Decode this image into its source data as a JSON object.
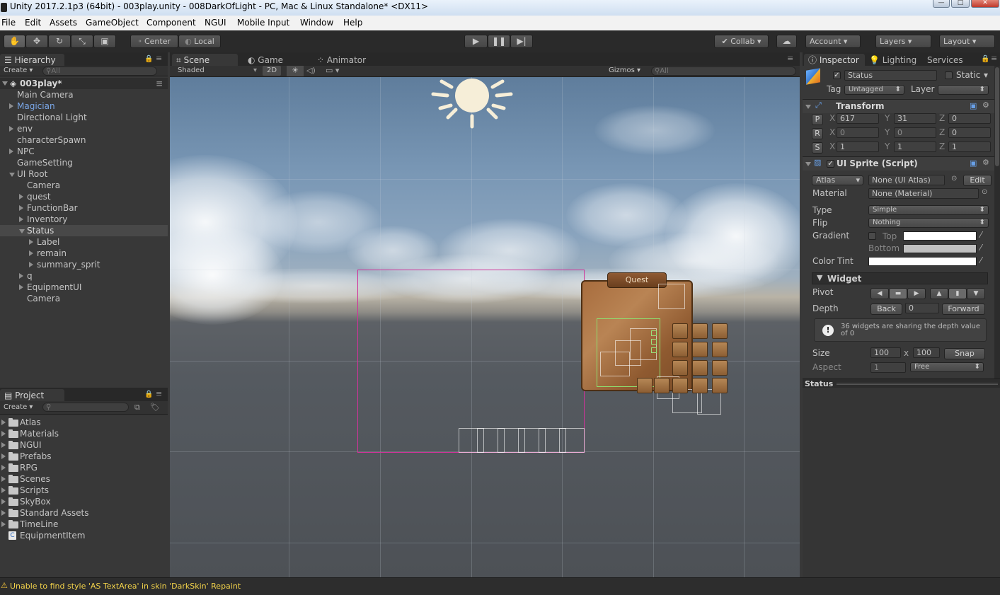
{
  "window": {
    "title": "Unity 2017.2.1p3 (64bit) - 003play.unity - 008DarkOfLight - PC, Mac & Linux Standalone* <DX11>",
    "min_label": "—",
    "max_label": "□",
    "close_label": "✕"
  },
  "menu": [
    "File",
    "Edit",
    "Assets",
    "GameObject",
    "Component",
    "NGUI",
    "Mobile Input",
    "Window",
    "Help"
  ],
  "toolbar": {
    "center": "Center",
    "local": "Local",
    "collab": "Collab",
    "account": "Account",
    "layers": "Layers",
    "layout": "Layout"
  },
  "hierarchy": {
    "tab": "Hierarchy",
    "create": "Create",
    "search_placeholder": "All",
    "scene_name": "003play*",
    "items": [
      {
        "label": "Main Camera",
        "depth": 1,
        "expand": "none",
        "color": "#c4c4c4"
      },
      {
        "label": "Magician",
        "depth": 1,
        "expand": "right",
        "color": "#7aa7e8"
      },
      {
        "label": "Directional Light",
        "depth": 1,
        "expand": "none",
        "color": "#c4c4c4"
      },
      {
        "label": "env",
        "depth": 1,
        "expand": "right",
        "color": "#c4c4c4"
      },
      {
        "label": "characterSpawn",
        "depth": 1,
        "expand": "none",
        "color": "#c4c4c4"
      },
      {
        "label": "NPC",
        "depth": 1,
        "expand": "right",
        "color": "#c4c4c4"
      },
      {
        "label": "GameSetting",
        "depth": 1,
        "expand": "none",
        "color": "#c4c4c4"
      },
      {
        "label": "UI Root",
        "depth": 1,
        "expand": "down",
        "color": "#c4c4c4"
      },
      {
        "label": "Camera",
        "depth": 2,
        "expand": "none",
        "color": "#c4c4c4"
      },
      {
        "label": "quest",
        "depth": 2,
        "expand": "right",
        "color": "#c4c4c4"
      },
      {
        "label": "FunctionBar",
        "depth": 2,
        "expand": "right",
        "color": "#c4c4c4"
      },
      {
        "label": "Inventory",
        "depth": 2,
        "expand": "right",
        "color": "#c4c4c4"
      },
      {
        "label": "Status",
        "depth": 2,
        "expand": "down",
        "color": "#dcdcdc",
        "selected": true
      },
      {
        "label": "Label",
        "depth": 3,
        "expand": "right",
        "color": "#c4c4c4"
      },
      {
        "label": "remain",
        "depth": 3,
        "expand": "right",
        "color": "#c4c4c4"
      },
      {
        "label": "summary_sprit",
        "depth": 3,
        "expand": "right",
        "color": "#c4c4c4"
      },
      {
        "label": "q",
        "depth": 2,
        "expand": "right",
        "color": "#c4c4c4"
      },
      {
        "label": "EquipmentUI",
        "depth": 2,
        "expand": "right",
        "color": "#c4c4c4"
      },
      {
        "label": "Camera",
        "depth": 2,
        "expand": "none",
        "color": "#c4c4c4"
      }
    ]
  },
  "project": {
    "tab": "Project",
    "create": "Create",
    "folders": [
      "Atlas",
      "Materials",
      "NGUI",
      "Prefabs",
      "RPG",
      "Scenes",
      "Scripts",
      "SkyBox",
      "Standard Assets",
      "TimeLine"
    ],
    "asset": "EquipmentItem"
  },
  "scene_view": {
    "tabs": [
      "Scene",
      "Game",
      "Animator"
    ],
    "shading": "Shaded",
    "mode_2d": "2D",
    "gizmos": "Gizmos",
    "search_placeholder": "All",
    "quest_title": "Quest"
  },
  "inspector": {
    "tabs": [
      "Inspector",
      "Lighting",
      "Services"
    ],
    "object_name": "Status",
    "static_label": "Static",
    "tag_label": "Tag",
    "tag_value": "Untagged",
    "layer_label": "Layer",
    "layer_value": "",
    "transform": {
      "title": "Transform",
      "position": {
        "x": "617",
        "y": "31",
        "z": "0"
      },
      "rotation": {
        "x": "0",
        "y": "0",
        "z": "0"
      },
      "scale": {
        "x": "1",
        "y": "1",
        "z": "1"
      },
      "p": "P",
      "r": "R",
      "s": "S",
      "xl": "X",
      "yl": "Y",
      "zl": "Z"
    },
    "sprite": {
      "title": "UI Sprite (Script)",
      "atlas_label": "Atlas",
      "atlas_value": "None (UI Atlas)",
      "edit": "Edit",
      "material_label": "Material",
      "material_value": "None (Material)",
      "type_label": "Type",
      "type_value": "Simple",
      "flip_label": "Flip",
      "flip_value": "Nothing",
      "gradient_label": "Gradient",
      "top_label": "Top",
      "bottom_label": "Bottom",
      "color_tint_label": "Color Tint",
      "gradient_top_color": "#ffffff",
      "gradient_bottom_color": "#c0c0c0",
      "color_tint": "#ffffff"
    },
    "widget": {
      "title": "Widget",
      "pivot_label": "Pivot",
      "depth_label": "Depth",
      "back": "Back",
      "depth_value": "0",
      "forward": "Forward",
      "warning": "36 widgets are sharing the depth value of 0",
      "size_label": "Size",
      "width": "100",
      "x_sep": "x",
      "height": "100",
      "snap": "Snap",
      "aspect_label": "Aspect",
      "aspect_value": "1",
      "aspect_mode": "Free"
    },
    "preview_title": "Status"
  },
  "status_message": "Unable to find style 'AS TextArea' in skin 'DarkSkin' Repaint"
}
